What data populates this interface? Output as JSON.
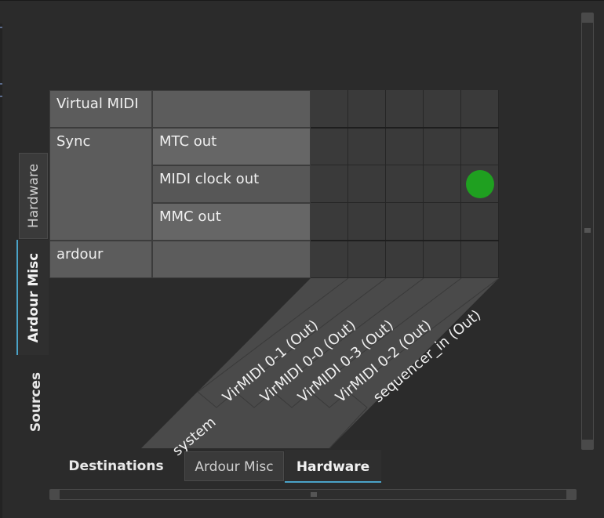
{
  "sources": {
    "groups": [
      {
        "label": "Virtual MIDI"
      },
      {
        "label": "Sync"
      },
      {
        "label": "ardour"
      }
    ],
    "channels": [
      "MTC out",
      "MIDI clock out",
      "MMC out"
    ]
  },
  "destinations": {
    "group_label": "system",
    "ports": [
      "VirMIDI 0-1 (Out)",
      "VirMIDI 0-0 (Out)",
      "VirMIDI 0-3 (Out)",
      "VirMIDI 0-2 (Out)",
      "sequencer_in (Out)"
    ]
  },
  "connections": [
    {
      "source": "MIDI clock out",
      "destination": "sequencer_in (Out)",
      "connected": true
    }
  ],
  "colors": {
    "connection": "#1fa020",
    "active_tab_accent": "#4aa3c8"
  },
  "source_tabs": {
    "title": "Sources",
    "tabs": [
      "Hardware",
      "Ardour Misc"
    ],
    "active": "Ardour Misc"
  },
  "destination_tabs": {
    "title": "Destinations",
    "tabs": [
      "Ardour Misc",
      "Hardware"
    ],
    "active": "Hardware"
  }
}
